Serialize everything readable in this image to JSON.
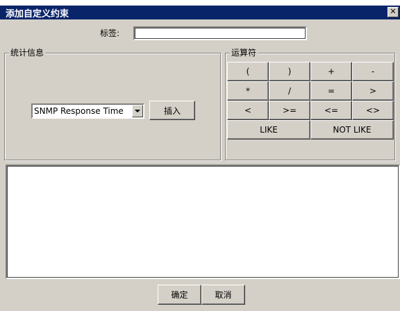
{
  "window": {
    "title": "添加自定义约束",
    "close_symbol": "✕"
  },
  "tag": {
    "label": "标签:",
    "value": ""
  },
  "stats": {
    "group_title": "统计信息",
    "selected_metric": "SNMP Response Time",
    "insert_label": "插入"
  },
  "operators": {
    "group_title": "运算符",
    "buttons": [
      "(",
      ")",
      "+",
      "-",
      "*",
      "/",
      "=",
      ">",
      "<",
      ">=",
      "<=",
      "<>"
    ],
    "like_label": "LIKE",
    "not_like_label": "NOT LIKE"
  },
  "expression": {
    "value": ""
  },
  "footer": {
    "ok_label": "确定",
    "cancel_label": "取消"
  }
}
